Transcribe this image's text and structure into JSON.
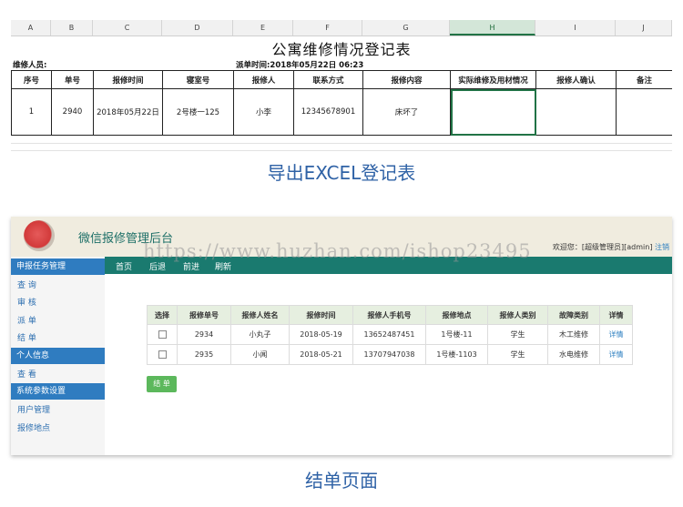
{
  "sheet": {
    "col_headers": [
      "A",
      "B",
      "C",
      "D",
      "E",
      "F",
      "G",
      "H",
      "I",
      "J"
    ],
    "selected_col": "H",
    "title": "公寓维修情况登记表",
    "repairer_label": "维修人员:",
    "dispatch_time": "派单时间:2018年05月22日 06:23",
    "headers": [
      "序号",
      "单号",
      "报修时间",
      "寝室号",
      "报修人",
      "联系方式",
      "报修内容",
      "实际维修及用材情况",
      "报修人确认",
      "备注"
    ],
    "row": [
      "1",
      "2940",
      "2018年05月22日",
      "2号楼一125",
      "小李",
      "12345678901",
      "床坏了",
      "",
      "",
      ""
    ]
  },
  "caption_top": "导出EXCEL登记表",
  "admin": {
    "title": "微信报修管理后台",
    "welcome": "欢迎您：[超级管理员][admin]",
    "logout": "注销",
    "nav": [
      "首页",
      "后退",
      "前进",
      "刷新"
    ],
    "sidebar": {
      "sections": [
        {
          "title": "申报任务管理",
          "items": [
            "查 询",
            "审 核",
            "派 单",
            "结 单"
          ]
        },
        {
          "title": "个人信息",
          "items": [
            "查 看"
          ]
        },
        {
          "title": "系统参数设置",
          "items": [
            "用户管理",
            "报修地点"
          ]
        }
      ]
    },
    "table": {
      "headers": [
        "选择",
        "报修单号",
        "报修人姓名",
        "报修时间",
        "报修人手机号",
        "报修地点",
        "报修人类别",
        "故障类别",
        "详情"
      ],
      "rows": [
        [
          "",
          "2934",
          "小丸子",
          "2018-05-19",
          "13652487451",
          "1号楼-11",
          "学生",
          "木工维修",
          "详情"
        ],
        [
          "",
          "2935",
          "小闻",
          "2018-05-21",
          "13707947038",
          "1号楼-1103",
          "学生",
          "水电维修",
          "详情"
        ]
      ]
    },
    "finish_button": "结 单",
    "watermark": "https://www.huzhan.com/ishop23495"
  },
  "caption_bottom": "结单页面"
}
